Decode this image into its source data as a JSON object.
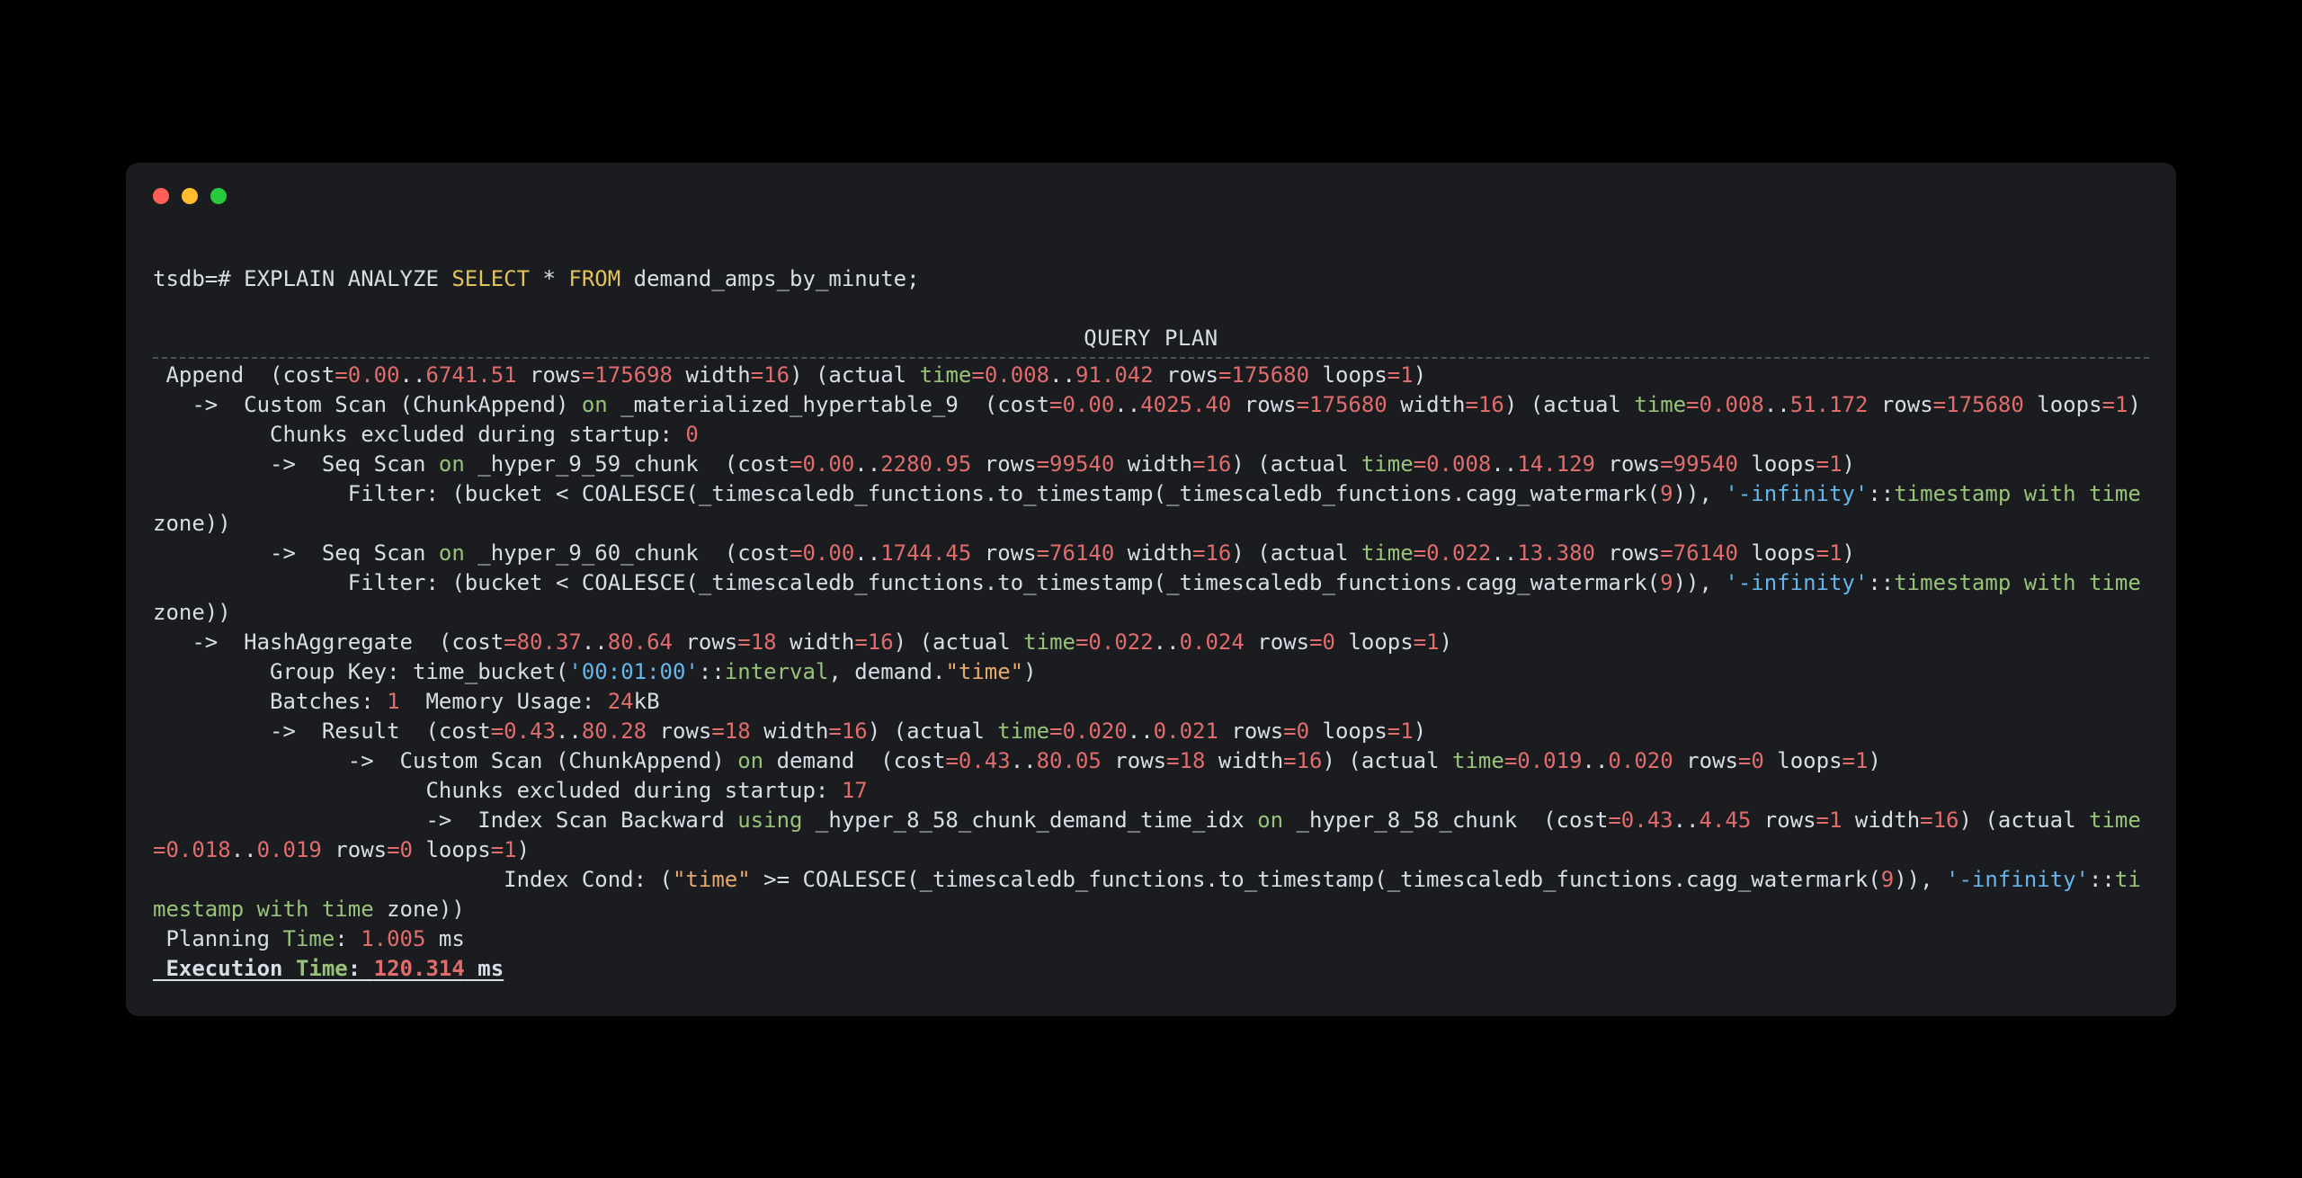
{
  "prompt": {
    "prefix": "tsdb=# ",
    "cmd1": "EXPLAIN ANALYZE ",
    "kw_select": "SELECT",
    "star": " * ",
    "kw_from": "FROM",
    "table": " demand_amps_by_minute;"
  },
  "plan_title": "QUERY PLAN",
  "plan": {
    "l1": {
      "a": " Append  (cost",
      "b": "=0.00",
      "c": "..",
      "d": "6741.51",
      "e": " rows",
      "f": "=175698",
      "g": " width",
      "h": "=16",
      "i": ") (actual ",
      "j": "time",
      "k": "=0.008",
      "l": "..",
      "m": "91.042",
      "n": " rows",
      "o": "=175680",
      "p": " loops",
      "q": "=1",
      "r": ")"
    },
    "l2": {
      "a": "   ->  Custom Scan (ChunkAppend) ",
      "b": "on",
      "c": " _materialized_hypertable_9  (cost",
      "d": "=0.00",
      "e": "..",
      "f": "4025.40",
      "g": " rows",
      "h": "=175680",
      "i": " width",
      "j": "=16",
      "k": ") (actual ",
      "l": "time",
      "m": "=0.008",
      "n": "..",
      "o": "51.172",
      "p": " rows",
      "q": "=175680",
      "r": " loops",
      "s": "=1",
      "t": ")"
    },
    "l3": {
      "a": "         Chunks excluded during startup: ",
      "b": "0"
    },
    "l4": {
      "a": "         ->  Seq Scan ",
      "b": "on",
      "c": " _hyper_9_59_chunk  (cost",
      "d": "=0.00",
      "e": "..",
      "f": "2280.95",
      "g": " rows",
      "h": "=99540",
      "i": " width",
      "j": "=16",
      "k": ") (actual ",
      "l": "time",
      "m": "=0.008",
      "n": "..",
      "o": "14.129",
      "p": " rows",
      "q": "=99540",
      "r": " loops",
      "s": "=1",
      "t": ")"
    },
    "l5": {
      "a": "               Filter: (bucket < COALESCE(_timescaledb_functions.to_timestamp(_timescaledb_functions.cagg_watermark(",
      "b": "9",
      "c": ")), ",
      "d": "'-infinity'",
      "e": "::",
      "f": "timestamp",
      "g": " ",
      "h": "with",
      "i": " ",
      "j": "time",
      "k": " zone))"
    },
    "l6": {
      "a": "         ->  Seq Scan ",
      "b": "on",
      "c": " _hyper_9_60_chunk  (cost",
      "d": "=0.00",
      "e": "..",
      "f": "1744.45",
      "g": " rows",
      "h": "=76140",
      "i": " width",
      "j": "=16",
      "k": ") (actual ",
      "l": "time",
      "m": "=0.022",
      "n": "..",
      "o": "13.380",
      "p": " rows",
      "q": "=76140",
      "r": " loops",
      "s": "=1",
      "t": ")"
    },
    "l7": {
      "a": "               Filter: (bucket < COALESCE(_timescaledb_functions.to_timestamp(_timescaledb_functions.cagg_watermark(",
      "b": "9",
      "c": ")), ",
      "d": "'-infinity'",
      "e": "::",
      "f": "timestamp",
      "g": " ",
      "h": "with",
      "i": " ",
      "j": "time",
      "k": " zone))"
    },
    "l8": {
      "a": "   ->  HashAggregate  (cost",
      "b": "=80.37",
      "c": "..",
      "d": "80.64",
      "e": " rows",
      "f": "=18",
      "g": " width",
      "h": "=16",
      "i": ") (actual ",
      "j": "time",
      "k": "=0.022",
      "l": "..",
      "m": "0.024",
      "n": " rows",
      "o": "=0",
      "p": " loops",
      "q": "=1",
      "r": ")"
    },
    "l9": {
      "a": "         Group Key: time_bucket(",
      "b": "'00:01:00'",
      "c": "::",
      "d": "interval",
      "e": ", demand.",
      "f": "\"time\"",
      "g": ")"
    },
    "l10": {
      "a": "         Batches: ",
      "b": "1",
      "c": "  Memory Usage: ",
      "d": "24",
      "e": "kB"
    },
    "l11": {
      "a": "         ->  Result  (cost",
      "b": "=0.43",
      "c": "..",
      "d": "80.28",
      "e": " rows",
      "f": "=18",
      "g": " width",
      "h": "=16",
      "i": ") (actual ",
      "j": "time",
      "k": "=0.020",
      "l": "..",
      "m": "0.021",
      "n": " rows",
      "o": "=0",
      "p": " loops",
      "q": "=1",
      "r": ")"
    },
    "l12": {
      "a": "               ->  Custom Scan (ChunkAppend) ",
      "b": "on",
      "c": " demand  (cost",
      "d": "=0.43",
      "e": "..",
      "f": "80.05",
      "g": " rows",
      "h": "=18",
      "i": " width",
      "j": "=16",
      "k": ") (actual ",
      "l": "time",
      "m": "=0.019",
      "n": "..",
      "o": "0.020",
      "p": " rows",
      "q": "=0",
      "r": " loops",
      "s": "=1",
      "t": ")"
    },
    "l13": {
      "a": "                     Chunks excluded during startup: ",
      "b": "17"
    },
    "l14": {
      "a": "                     ->  Index Scan Backward ",
      "b": "using",
      "c": " _hyper_8_58_chunk_demand_time_idx ",
      "d": "on",
      "e": " _hyper_8_58_chunk  (cost",
      "f": "=0.43",
      "g": "..",
      "h": "4.45",
      "i": " rows",
      "j": "=1",
      "k": " width",
      "l": "=16",
      "m": ") (actual ",
      "n": "time",
      "o": "=0.018",
      "p": "..",
      "q": "0.019",
      "r": " rows",
      "s": "=0",
      "t": " loops",
      "u": "=1",
      "v": ")"
    },
    "l15": {
      "a": "                           Index Cond: (",
      "b": "\"time\"",
      "c": " >= COALESCE(_timescaledb_functions.to_timestamp(_timescaledb_functions.cagg_watermark(",
      "d": "9",
      "e": ")), ",
      "f": "'-infinity'",
      "g": "::",
      "h": "timestamp",
      "i": " ",
      "j": "with",
      "k": " ",
      "l": "time",
      "m": " zone))"
    },
    "l16": {
      "a": " Planning ",
      "b": "Time",
      "c": ": ",
      "d": "1.005",
      "e": " ms"
    },
    "l17": {
      "a": " Execution ",
      "b": "Time",
      "c": ": ",
      "d": "120.314",
      "e": " ms"
    }
  }
}
